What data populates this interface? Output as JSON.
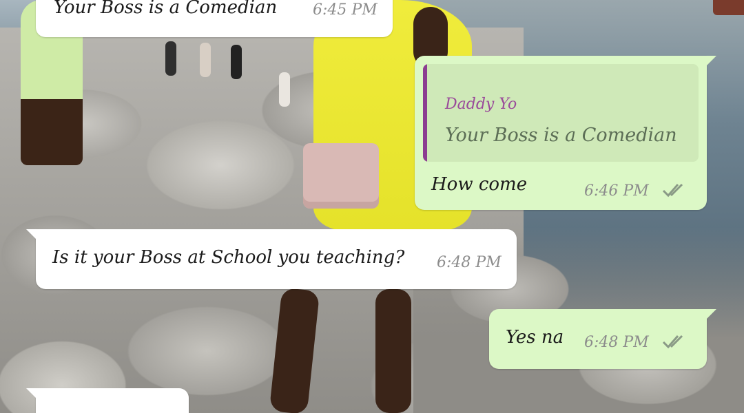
{
  "messages": [
    {
      "direction": "incoming",
      "text": "Your Boss is a Comedian",
      "time": "6:45 PM"
    },
    {
      "direction": "outgoing",
      "reply_to": {
        "author": "Daddy Yo",
        "text": "Your Boss is a Comedian"
      },
      "text": "How come",
      "time": "6:46 PM",
      "status": "read-double-check-icon"
    },
    {
      "direction": "incoming",
      "text": "Is it your Boss at School you teaching?",
      "time": "6:48 PM"
    },
    {
      "direction": "outgoing",
      "text": "Yes na",
      "time": "6:48 PM",
      "status": "read-double-check-icon"
    },
    {
      "direction": "incoming",
      "text": ""
    }
  ],
  "colors": {
    "incoming_bubble": "#ffffff",
    "outgoing_bubble": "#dcf8c6",
    "quote_accent": "#8c3d91",
    "timestamp": "#8c8c8c"
  }
}
